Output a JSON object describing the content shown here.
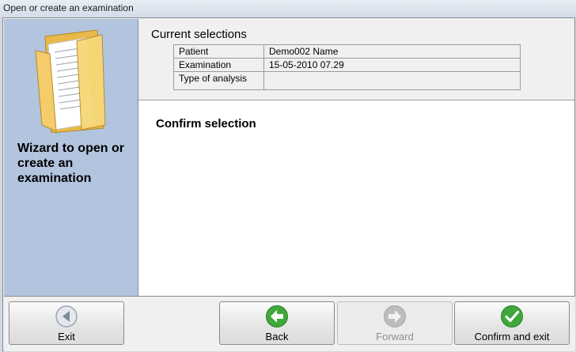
{
  "window": {
    "title": "Open or create an examination"
  },
  "sidebar": {
    "wizard_text": "Wizard to open or create an examination"
  },
  "header": {
    "title": "Current selections",
    "rows": [
      {
        "label": "Patient",
        "value": "Demo002 Name"
      },
      {
        "label": "Examination",
        "value": "15-05-2010 07.29"
      },
      {
        "label": "Type of analysis",
        "value": ""
      }
    ]
  },
  "content": {
    "title": "Confirm selection"
  },
  "footer": {
    "exit_label": "Exit",
    "back_label": "Back",
    "forward_label": "Forward",
    "confirm_label": "Confirm and exit"
  },
  "colors": {
    "sidebar_bg": "#b2c4de",
    "back_icon": "#3fa83a",
    "confirm_icon": "#3fa83a",
    "forward_icon_disabled": "#b7b7b7",
    "exit_icon": "#8e9aa8"
  },
  "icons": {
    "folder": "open-folder-icon",
    "exit": "circle-left-arrow-icon",
    "back": "green-left-arrow-icon",
    "forward": "gray-right-arrow-icon",
    "confirm": "green-checkmark-icon"
  }
}
